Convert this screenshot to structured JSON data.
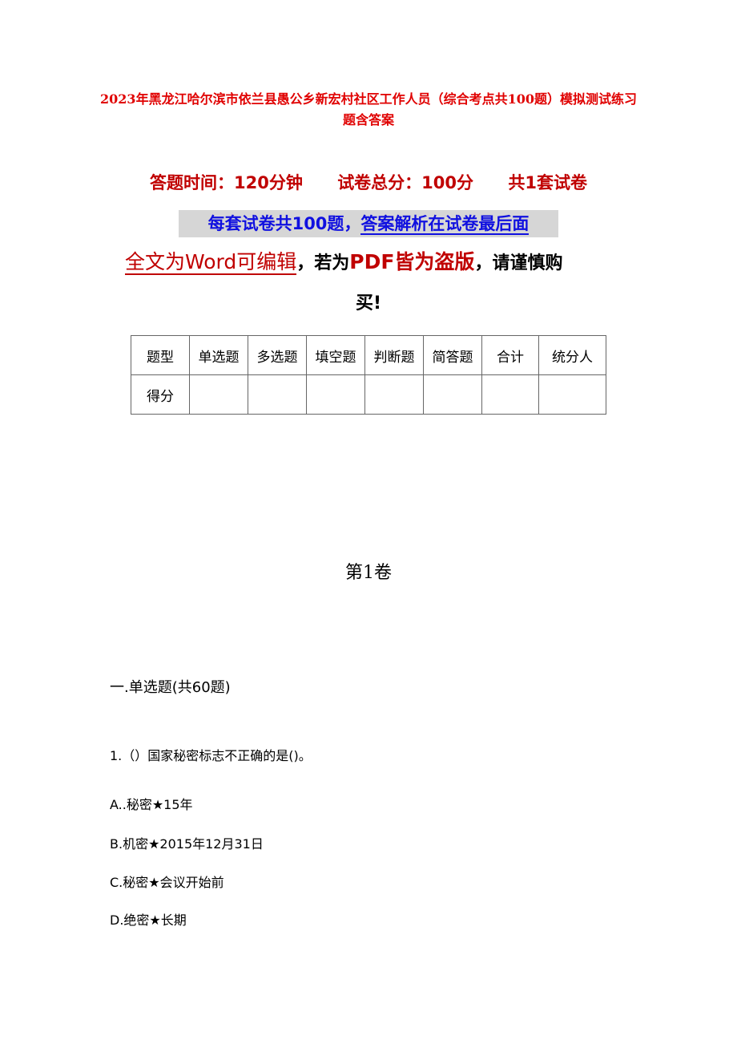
{
  "title": "2023年黑龙江哈尔滨市依兰县愚公乡新宏村社区工作人员（综合考点共100题）模拟测试练习题含答案",
  "meta": {
    "time": "答题时间：120分钟",
    "total": "试卷总分：100分",
    "sets": "共1套试卷"
  },
  "notice": {
    "part1": "每套试卷共100题，",
    "part2": "答案解析在试卷最后面"
  },
  "warning": {
    "part1": "全文为Word可编辑",
    "comma1": "，若为",
    "part2": "PDF皆为盗版",
    "part3": "，请谨慎购",
    "part4": "买!"
  },
  "score_table": {
    "header": [
      "题型",
      "单选题",
      "多选题",
      "填空题",
      "判断题",
      "简答题",
      "合计",
      "统分人"
    ],
    "row": [
      "得分",
      "",
      "",
      "",
      "",
      "",
      "",
      ""
    ]
  },
  "volume": "第1卷",
  "section": "一.单选题(共60题)",
  "question": {
    "stem": "1.（）国家秘密标志不正确的是()。",
    "options": [
      "A..秘密★15年",
      "B.机密★2015年12月31日",
      "C.秘密★会议开始前",
      "D.绝密★长期"
    ]
  }
}
